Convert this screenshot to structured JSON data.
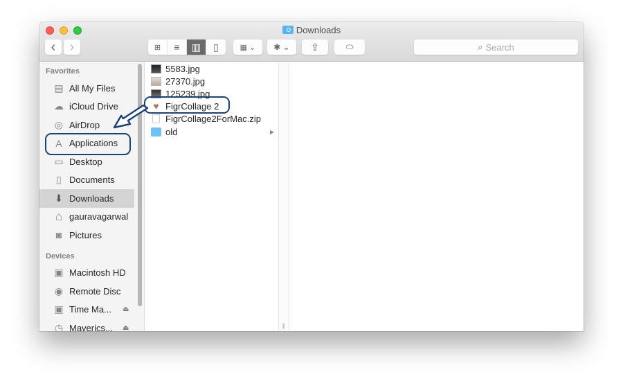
{
  "window": {
    "title": "Downloads",
    "title_icon": "folder-icon"
  },
  "toolbar": {
    "back_icon": "‹",
    "forward_icon": "›",
    "view_modes": [
      {
        "name": "icon-view",
        "glyph": "⊞",
        "active": false
      },
      {
        "name": "list-view",
        "glyph": "≡",
        "active": false
      },
      {
        "name": "column-view",
        "glyph": "▥",
        "active": true
      },
      {
        "name": "cover-flow-view",
        "glyph": "▯",
        "active": false
      }
    ],
    "arrange_glyph": "▦ ⌄",
    "action_glyph": "✱ ⌄",
    "share_glyph": "⇪",
    "tags_glyph": "⬭",
    "search_placeholder": "Search",
    "search_icon": "⌕"
  },
  "sidebar": {
    "sections": [
      {
        "title": "Favorites",
        "items": [
          {
            "label": "All My Files",
            "icon": "all-files-icon",
            "glyph": "▤",
            "selected": false
          },
          {
            "label": "iCloud Drive",
            "icon": "cloud-icon",
            "glyph": "☁",
            "selected": false
          },
          {
            "label": "AirDrop",
            "icon": "airdrop-icon",
            "glyph": "◎",
            "selected": false
          },
          {
            "label": "Applications",
            "icon": "applications-icon",
            "glyph": "A",
            "selected": false
          },
          {
            "label": "Desktop",
            "icon": "desktop-icon",
            "glyph": "▭",
            "selected": false
          },
          {
            "label": "Documents",
            "icon": "documents-icon",
            "glyph": "▯",
            "selected": false
          },
          {
            "label": "Downloads",
            "icon": "downloads-icon",
            "glyph": "⬇",
            "selected": true
          },
          {
            "label": "gauravagarwal",
            "icon": "home-icon",
            "glyph": "⌂",
            "selected": false
          },
          {
            "label": "Pictures",
            "icon": "camera-icon",
            "glyph": "◙",
            "selected": false
          }
        ]
      },
      {
        "title": "Devices",
        "items": [
          {
            "label": "Macintosh HD",
            "icon": "hard-drive-icon",
            "glyph": "▣",
            "selected": false
          },
          {
            "label": "Remote Disc",
            "icon": "disc-icon",
            "glyph": "◉",
            "selected": false
          },
          {
            "label": "Time Ma...",
            "icon": "hard-drive-icon",
            "glyph": "▣",
            "selected": false,
            "eject": "⏏"
          },
          {
            "label": "Maverics...",
            "icon": "time-machine-icon",
            "glyph": "◷",
            "selected": false,
            "eject": "⏏"
          }
        ]
      }
    ]
  },
  "files": [
    {
      "name": "5583.jpg",
      "type": "image-dark"
    },
    {
      "name": "27370.jpg",
      "type": "image-light"
    },
    {
      "name": "125239.jpg",
      "type": "image-mid"
    },
    {
      "name": "FigrCollage 2",
      "type": "app",
      "glyph": "♥"
    },
    {
      "name": "FigrCollage2ForMac.zip",
      "type": "zip"
    },
    {
      "name": "old",
      "type": "folder",
      "disclosure": "▶"
    }
  ],
  "column_resize_glyph": "||",
  "annotation": {
    "color": "#1e4275",
    "from": "FigrCollage 2",
    "to": "Applications"
  }
}
